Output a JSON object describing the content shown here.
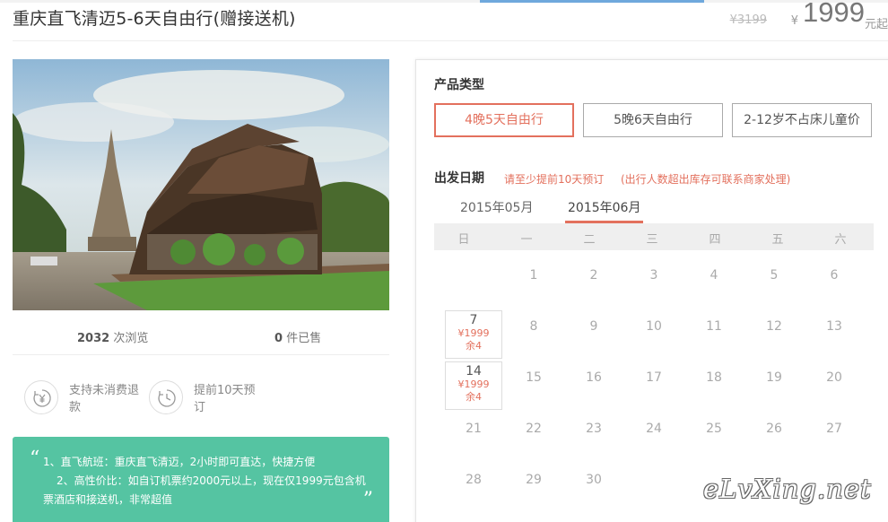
{
  "header": {
    "title": "重庆直飞清迈5-6天自由行(赠接送机)",
    "old_price": "¥3199",
    "currency": "¥",
    "price": "1999",
    "price_suffix": "元起"
  },
  "stats": {
    "views_count": "2032",
    "views_label": "次浏览",
    "sold_count": "0",
    "sold_label": "件已售"
  },
  "features": [
    {
      "icon": "yen-refund-icon",
      "text": "支持未消费退款"
    },
    {
      "icon": "clock-icon",
      "text": "提前10天预订"
    }
  ],
  "highlights": {
    "line1": "1、直飞航班：重庆直飞清迈，2小时即可直达，快捷方便",
    "line2": "2、高性价比：如自订机票约2000元以上，现在仅1999元包含机",
    "line3": "票酒店和接送机，非常超值"
  },
  "product_type": {
    "label": "产品类型",
    "options": [
      "4晚5天自由行",
      "5晚6天自由行",
      "2-12岁不占床儿童价"
    ],
    "selected_index": 0
  },
  "departure": {
    "label": "出发日期",
    "note1": "请至少提前10天预订",
    "note2": "(出行人数超出库存可联系商家处理)",
    "months": [
      "2015年05月",
      "2015年06月"
    ],
    "active_month_index": 1,
    "weekdays": [
      "日",
      "一",
      "二",
      "三",
      "四",
      "五",
      "六"
    ],
    "first_weekday": 1,
    "days_in_month": 30,
    "available": {
      "7": {
        "price": "¥1999",
        "remain": "余4"
      },
      "14": {
        "price": "¥1999",
        "remain": "余4"
      }
    }
  },
  "watermark": "eLvXing.net",
  "colors": {
    "accent": "#e3705d",
    "highlight_bg": "#55c4a2"
  }
}
